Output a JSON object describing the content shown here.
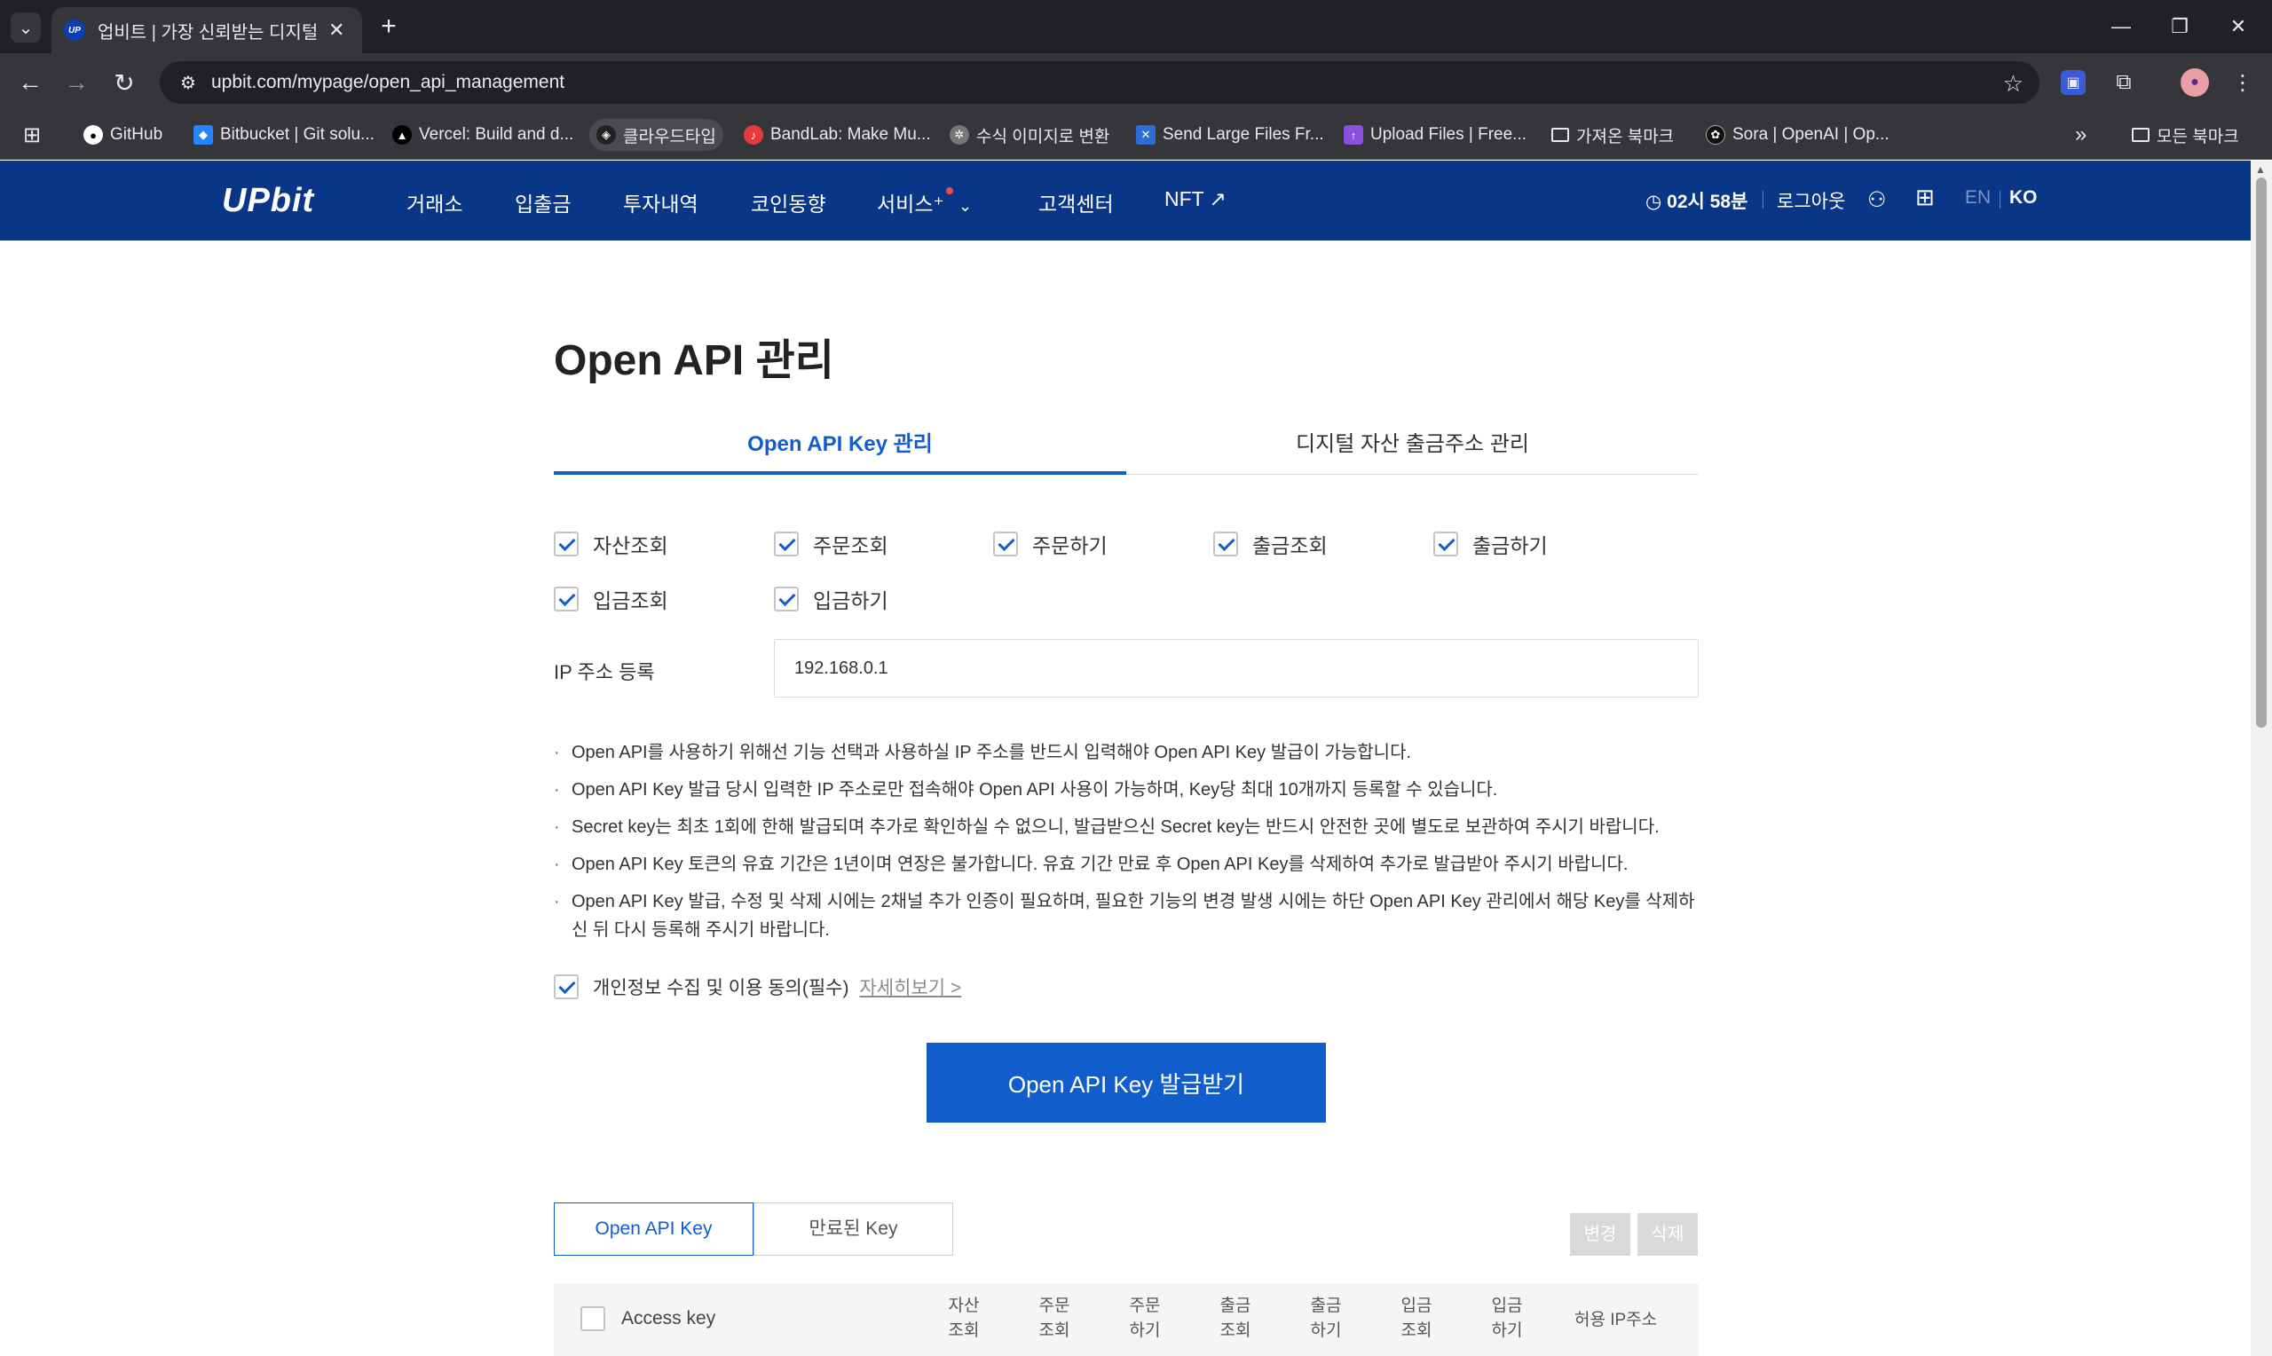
{
  "browser": {
    "tab_title": "업비트 | 가장 신뢰받는 디지털",
    "url": "upbit.com/mypage/open_api_management",
    "bookmarks": [
      "GitHub",
      "Bitbucket | Git solu...",
      "Vercel: Build and d...",
      "클라우드타입",
      "BandLab: Make Mu...",
      "수식 이미지로 변환",
      "Send Large Files Fr...",
      "Upload Files | Free...",
      "가져온 북마크",
      "Sora | OpenAI | Op..."
    ],
    "all_bookmarks": "모든 북마크",
    "overflow": "»"
  },
  "header": {
    "logo": "UPbit",
    "nav": [
      "거래소",
      "입출금",
      "투자내역",
      "코인동향",
      "서비스⁺",
      "고객센터",
      "NFT ↗"
    ],
    "session_time": "02시 58분",
    "logout": "로그아웃",
    "lang_en": "EN",
    "lang_ko": "KO"
  },
  "page": {
    "title": "Open API 관리",
    "tabs": [
      "Open API Key 관리",
      "디지털 자산 출금주소 관리"
    ],
    "permissions": [
      "자산조회",
      "주문조회",
      "주문하기",
      "출금조회",
      "출금하기",
      "입금조회",
      "입금하기"
    ],
    "ip_label": "IP 주소 등록",
    "ip_value": "192.168.0.1",
    "notes": [
      "Open API를 사용하기 위해선 기능 선택과 사용하실 IP 주소를 반드시 입력해야 Open API Key 발급이 가능합니다.",
      "Open API Key 발급 당시 입력한 IP 주소로만 접속해야 Open API 사용이 가능하며, Key당 최대 10개까지 등록할 수 있습니다.",
      "Secret key는 최초 1회에 한해 발급되며 추가로 확인하실 수 없으니, 발급받으신 Secret key는 반드시 안전한 곳에 별도로 보관하여 주시기 바랍니다.",
      "Open API Key 토큰의 유효 기간은 1년이며 연장은 불가합니다. 유효 기간 만료 후 Open API Key를 삭제하여 추가로 발급받아 주시기 바랍니다.",
      "Open API Key 발급, 수정 및 삭제 시에는 2채널 추가 인증이 필요하며, 필요한 기능의 변경 발생 시에는 하단 Open API Key 관리에서 해당 Key를 삭제하신 뒤 다시 등록해 주시기 바랍니다."
    ],
    "agree_label": "개인정보 수집 및 이용 동의(필수)",
    "agree_link": "자세히보기 >",
    "issue_button": "Open API Key 발급받기",
    "key_tabs": [
      "Open API Key",
      "만료된 Key"
    ],
    "edit_button": "변경",
    "delete_button": "삭제",
    "table_headers": {
      "access_key": "Access key",
      "cols": [
        [
          "자산",
          "조회"
        ],
        [
          "주문",
          "조회"
        ],
        [
          "주문",
          "하기"
        ],
        [
          "출금",
          "조회"
        ],
        [
          "출금",
          "하기"
        ],
        [
          "입금",
          "조회"
        ],
        [
          "입금",
          "하기"
        ]
      ],
      "ip": "허용 IP주소"
    }
  },
  "colors": {
    "brand": "#093687",
    "accent": "#115dcb"
  }
}
